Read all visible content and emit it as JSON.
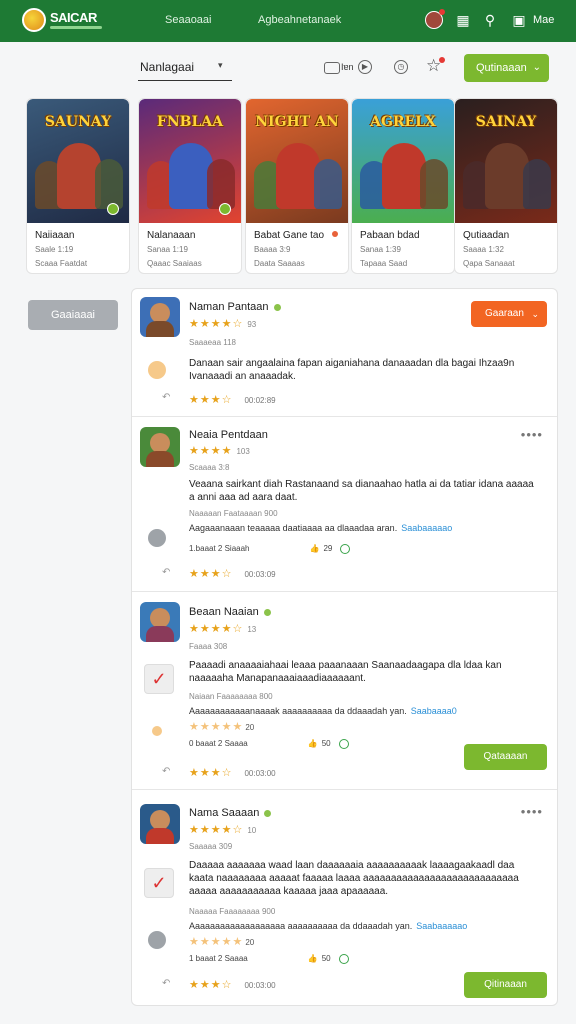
{
  "topbar": {
    "logo_text": "SAICAR",
    "nav_1": "Seaaoaai",
    "nav_2": "Agbeahnetanaek",
    "me_label": "Mae"
  },
  "filter": {
    "dropdown_value": "Nanlagaai",
    "view_label": "Iɐn",
    "button_label": "Qutinaaan"
  },
  "games": [
    {
      "art_title": "SAUNAY",
      "name": "Naiiaaan",
      "meta1": "Saale 1:19",
      "meta2": "Scaaa Faatdat",
      "palette": [
        "#3a5a7a",
        "#1f2a44"
      ],
      "fig": "#b5432f"
    },
    {
      "art_title": "FNBLAA",
      "name": "Nalanaaan",
      "meta1": "Sanaa 1:19",
      "meta2": "Qaaac Saaiaas",
      "palette": [
        "#5a2a7a",
        "#e2442f"
      ],
      "fig": "#3b5fbf"
    },
    {
      "art_title": "NIGHT AN",
      "name": "Babat Gane tao",
      "meta1": "Baaaa 3:9",
      "meta2": "Daata Saaaas",
      "palette": [
        "#e2662f",
        "#7a3a1f"
      ],
      "fig": "#c0392b"
    },
    {
      "art_title": "AGRELX",
      "name": "Pabaan bdad",
      "meta1": "Sanaa 1:39",
      "meta2": "Tapaaa Saad",
      "palette": [
        "#3aa0d8",
        "#4bae4f"
      ],
      "fig": "#c0392b"
    },
    {
      "art_title": "SAINAY",
      "name": "Qutiaadan",
      "meta1": "Saaaa 1:32",
      "meta2": "Qapa Sanaaat",
      "palette": [
        "#2a1f1f",
        "#7a2a1a"
      ],
      "fig": "#6b3b2a"
    }
  ],
  "side_button": "Gaaiaaai",
  "reviews": [
    {
      "name": "Naman Pantaan",
      "rating_num": "93",
      "date": "Saaaeaa 118",
      "body": "Danaan sair angaalaina fapan aiganiahana danaaadan dla bagai Ihzaa9n Ivanaaadi an anaaadak.",
      "bottom_date": "00:02:89",
      "button_label": "Gaaraan",
      "avatar_colors": [
        "#3d6fb6",
        "#7a4a2a"
      ]
    },
    {
      "name": "Neaia Pentdaan",
      "rating_num": "103",
      "date": "Scaaaa 3:8",
      "body": "Veaana sairkant diah Rastanaand sa dianaahao hatla ai da tatiar idana aaaaa a anni aaa ad aara daat.",
      "sub": "Naaaaan Faataaaan 900",
      "answer": "Aagaaanaaan teaaaaa daatiaaaa aa dlaaadaa aran.",
      "answer_link": "Saabaaaaao",
      "helpful_text": "1.baaat 2 Siaaah",
      "helpful_count": "29",
      "bottom_date": "00:03:09",
      "avatar_colors": [
        "#4a8a3a",
        "#8a4a2a"
      ]
    },
    {
      "name": "Beaan Naaian",
      "rating_num": "13",
      "date": "Faaaa 308",
      "body": "Paaaadi anaaaaiahaai leaaa paaanaaan Saanaadaagapa dla ldaa kan naaaaaha Manapanaaaiaaadiaaaaaant.",
      "sub": "Naiaan Faaaaaaaa 800",
      "answer": "Aaaaaaaaaaaanaaaak aaaaaaaaaa da ddaaadah yan.",
      "answer_link": "Saabaaaa0",
      "rating_row_num": "20",
      "helpful_text": "0 baaat 2 Saaaa",
      "helpful_count": "50",
      "bottom_date": "00:03:00",
      "button_label": "Qataaaan",
      "avatar_colors": [
        "#3a7ab8",
        "#8a3a5a"
      ]
    },
    {
      "name": "Nama Saaaan",
      "rating_num": "10",
      "date": "Saaaaa 309",
      "body": "Daaaaa aaaaaaa waad laan daaaaaaia aaaaaaaaaak laaaagaakaadl daa kaata naaaaaaaa aaaaat faaaaa laaaa aaaaaaaaaaaaaaaaaaaaaaaaaaaa aaaaa aaaaaaaaaaa kaaaaa jaaa apaaaaaa.",
      "sub": "Naaaaa Faaaaaaaa 900",
      "answer": "Aaaaaaaaaaaaaaaaaaa aaaaaaaaaa da ddaaadah yan.",
      "answer_link": "Saabaaaaao",
      "rating_row_num": "20",
      "helpful_text": "1 baaat 2 Saaaa",
      "helpful_count": "50",
      "bottom_date": "00:03:00",
      "button_label": "Qitinaaan",
      "avatar_colors": [
        "#2a5a8a",
        "#c0392b"
      ]
    }
  ],
  "colors": {
    "brand_green": "#1e7a34",
    "accent_green": "#7cb82f",
    "accent_orange": "#f26522",
    "star": "#e7a21b",
    "link": "#2a8fd6"
  }
}
